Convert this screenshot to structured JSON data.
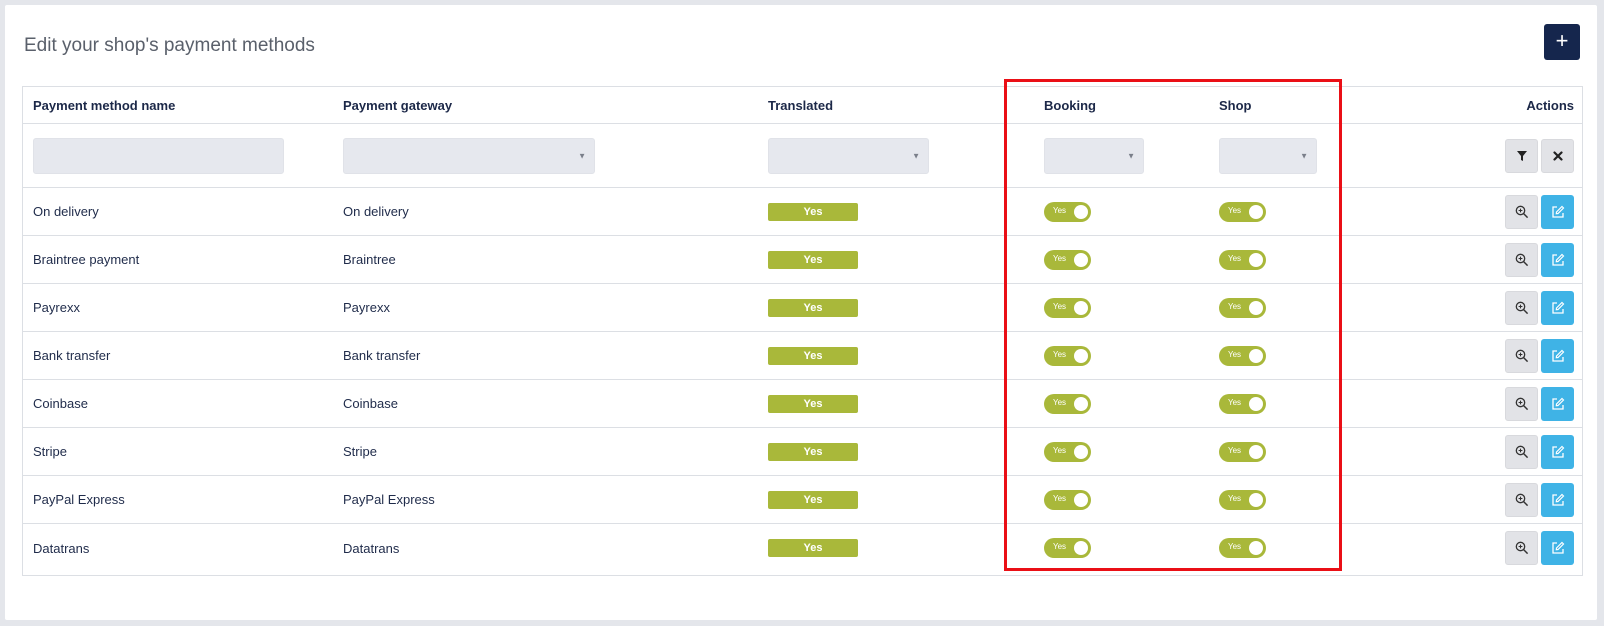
{
  "page": {
    "title": "Edit your shop's payment methods",
    "add_label": "+"
  },
  "columns": {
    "name": "Payment method name",
    "gateway": "Payment gateway",
    "translated": "Translated",
    "booking": "Booking",
    "shop": "Shop",
    "actions": "Actions"
  },
  "filters": {
    "name_value": "",
    "gateway_value": "",
    "translated_value": "",
    "booking_value": "",
    "shop_value": "",
    "filter_icon": "filter-icon",
    "clear_icon": "close-icon"
  },
  "rows": [
    {
      "name": "On delivery",
      "gateway": "On delivery",
      "translated": "Yes",
      "booking": "Yes",
      "shop": "Yes"
    },
    {
      "name": "Braintree payment",
      "gateway": "Braintree",
      "translated": "Yes",
      "booking": "Yes",
      "shop": "Yes"
    },
    {
      "name": "Payrexx",
      "gateway": "Payrexx",
      "translated": "Yes",
      "booking": "Yes",
      "shop": "Yes"
    },
    {
      "name": "Bank transfer",
      "gateway": "Bank transfer",
      "translated": "Yes",
      "booking": "Yes",
      "shop": "Yes"
    },
    {
      "name": "Coinbase",
      "gateway": "Coinbase",
      "translated": "Yes",
      "booking": "Yes",
      "shop": "Yes"
    },
    {
      "name": "Stripe",
      "gateway": "Stripe",
      "translated": "Yes",
      "booking": "Yes",
      "shop": "Yes"
    },
    {
      "name": "PayPal Express",
      "gateway": "PayPal Express",
      "translated": "Yes",
      "booking": "Yes",
      "shop": "Yes"
    },
    {
      "name": "Datatrans",
      "gateway": "Datatrans",
      "translated": "Yes",
      "booking": "Yes",
      "shop": "Yes"
    }
  ],
  "colors": {
    "accent_dark": "#15264d",
    "badge_green": "#a9b83a",
    "edit_blue": "#3fb3e6",
    "highlight_red": "#ea0f16"
  }
}
